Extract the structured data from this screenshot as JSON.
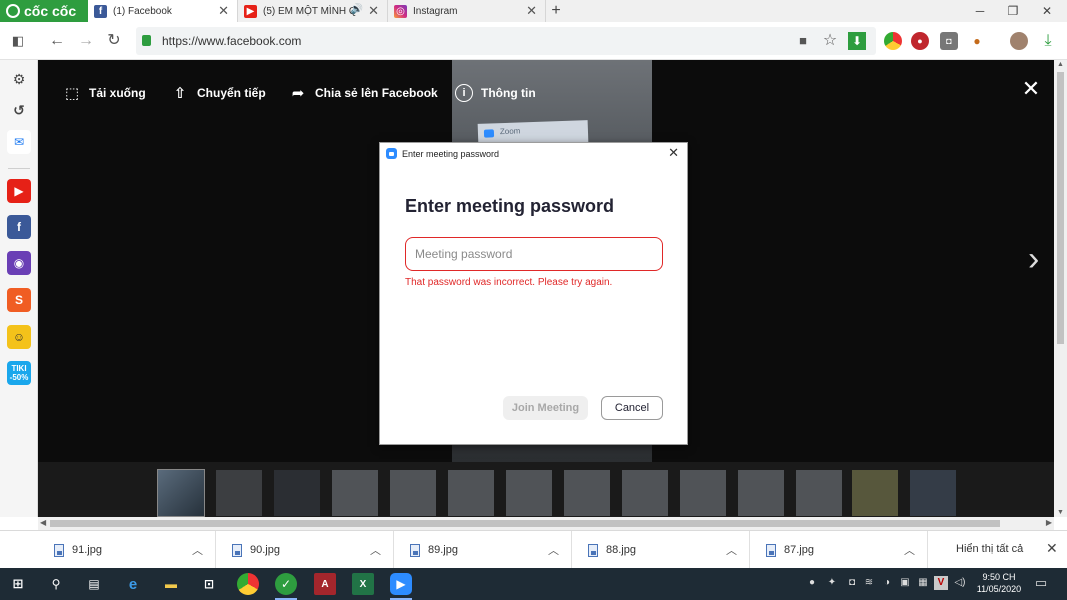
{
  "browser": {
    "brand": "cốc cốc",
    "tabs": [
      {
        "title": "(1) Facebook",
        "active": true
      },
      {
        "title": "(5) EM MỘT MÌNH Q",
        "active": false
      },
      {
        "title": "Instagram",
        "active": false
      }
    ],
    "url": "https://www.facebook.com"
  },
  "viewer": {
    "actions": [
      {
        "label": "Tải xuống",
        "icon": "download-icon"
      },
      {
        "label": "Chuyển tiếp",
        "icon": "upload-icon"
      },
      {
        "label": "Chia sẻ lên Facebook",
        "icon": "share-arrow-icon"
      },
      {
        "label": "Thông tin",
        "icon": "info-icon"
      }
    ],
    "photo_text": "Zoom"
  },
  "dialog": {
    "window_title": "Enter meeting password",
    "heading": "Enter meeting password",
    "password_placeholder": "Meeting password",
    "error": "That password was incorrect. Please try again.",
    "join_label": "Join Meeting",
    "cancel_label": "Cancel"
  },
  "sidebar": {
    "promo_label": "TIKI",
    "promo_discount": "-50%"
  },
  "downloads": {
    "files": [
      "91.jpg",
      "90.jpg",
      "89.jpg",
      "88.jpg",
      "87.jpg"
    ],
    "show_all": "Hiển thị tất cả"
  },
  "taskbar": {
    "time": "9:50 CH",
    "date": "11/05/2020"
  },
  "colors": {
    "error_red": "#e02828",
    "zoom_blue": "#2d8cff",
    "coccoc_green": "#2e9d3f",
    "viewer_bg": "#0c0c0c"
  }
}
